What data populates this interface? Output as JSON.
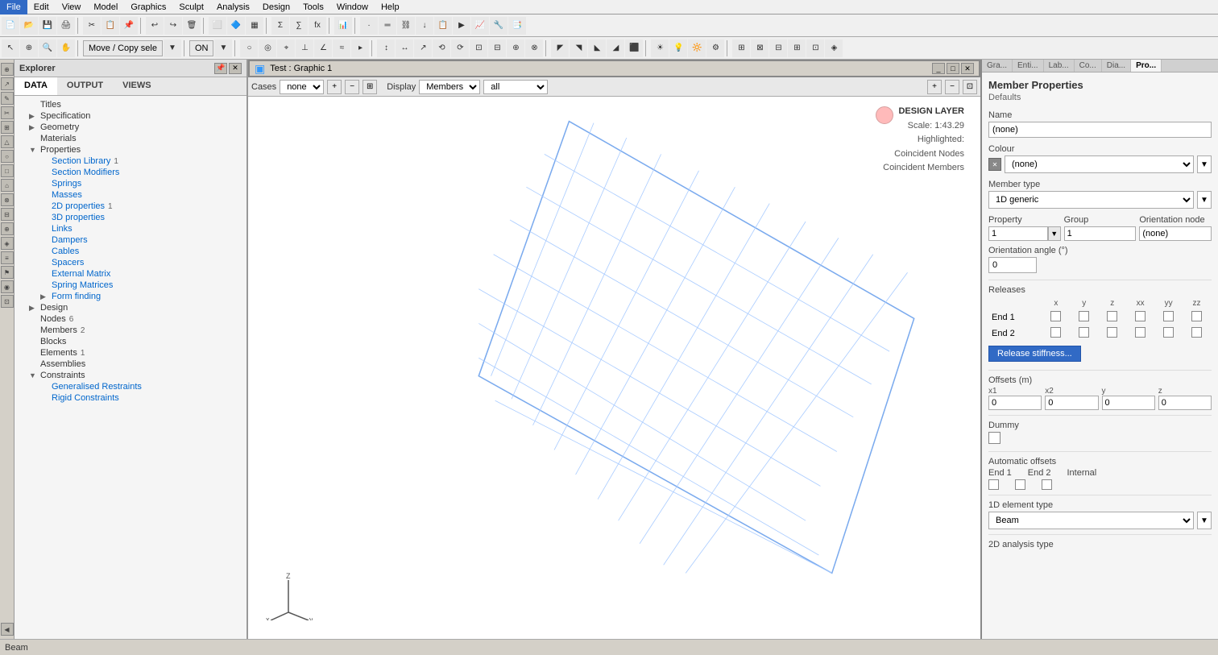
{
  "menubar": {
    "items": [
      "File",
      "Edit",
      "View",
      "Model",
      "Graphics",
      "Sculpt",
      "Analysis",
      "Design",
      "Tools",
      "Window",
      "Help"
    ]
  },
  "explorer": {
    "title": "Explorer",
    "tabs": [
      "DATA",
      "OUTPUT",
      "VIEWS"
    ],
    "active_tab": "DATA",
    "tree": [
      {
        "label": "Titles",
        "indent": 1,
        "type": "leaf",
        "color": "black"
      },
      {
        "label": "Specification",
        "indent": 1,
        "type": "branch",
        "color": "black"
      },
      {
        "label": "Geometry",
        "indent": 1,
        "type": "branch",
        "color": "black"
      },
      {
        "label": "Materials",
        "indent": 1,
        "type": "leaf",
        "color": "black"
      },
      {
        "label": "Properties",
        "indent": 1,
        "type": "branch",
        "color": "black",
        "expanded": true
      },
      {
        "label": "Section Library",
        "indent": 2,
        "type": "leaf",
        "color": "blue",
        "count": "1"
      },
      {
        "label": "Section Modifiers",
        "indent": 2,
        "type": "leaf",
        "color": "blue"
      },
      {
        "label": "Springs",
        "indent": 2,
        "type": "leaf",
        "color": "blue"
      },
      {
        "label": "Masses",
        "indent": 2,
        "type": "leaf",
        "color": "blue"
      },
      {
        "label": "2D properties",
        "indent": 2,
        "type": "leaf",
        "color": "blue",
        "count": "1"
      },
      {
        "label": "3D properties",
        "indent": 2,
        "type": "leaf",
        "color": "blue"
      },
      {
        "label": "Links",
        "indent": 2,
        "type": "leaf",
        "color": "blue"
      },
      {
        "label": "Dampers",
        "indent": 2,
        "type": "leaf",
        "color": "blue"
      },
      {
        "label": "Cables",
        "indent": 2,
        "type": "leaf",
        "color": "blue"
      },
      {
        "label": "Spacers",
        "indent": 2,
        "type": "leaf",
        "color": "blue"
      },
      {
        "label": "External Matrix",
        "indent": 2,
        "type": "leaf",
        "color": "blue"
      },
      {
        "label": "Spring Matrices",
        "indent": 2,
        "type": "leaf",
        "color": "blue"
      },
      {
        "label": "Form finding",
        "indent": 2,
        "type": "branch",
        "color": "blue"
      },
      {
        "label": "Design",
        "indent": 1,
        "type": "branch",
        "color": "black"
      },
      {
        "label": "Nodes",
        "indent": 1,
        "type": "leaf",
        "color": "black",
        "count": "6"
      },
      {
        "label": "Members",
        "indent": 1,
        "type": "leaf",
        "color": "black",
        "count": "2"
      },
      {
        "label": "Blocks",
        "indent": 1,
        "type": "leaf",
        "color": "black"
      },
      {
        "label": "Elements",
        "indent": 1,
        "type": "leaf",
        "color": "black",
        "count": "1"
      },
      {
        "label": "Assemblies",
        "indent": 1,
        "type": "leaf",
        "color": "black"
      },
      {
        "label": "Constraints",
        "indent": 1,
        "type": "branch",
        "color": "black",
        "expanded": true
      },
      {
        "label": "Generalised Restraints",
        "indent": 2,
        "type": "leaf",
        "color": "blue"
      },
      {
        "label": "Rigid Constraints",
        "indent": 2,
        "type": "leaf",
        "color": "blue"
      }
    ]
  },
  "viewport": {
    "title": "Test : Graphic 1",
    "cases_label": "Cases",
    "cases_value": "none",
    "display_label": "Display",
    "display_value": "Members",
    "all_value": "all",
    "design_layer": "DESIGN LAYER",
    "scale": "Scale: 1:43.29",
    "highlighted": "Highlighted:",
    "coincident_nodes": "Coincident Nodes",
    "coincident_members": "Coincident Members"
  },
  "right_panel": {
    "tabs": [
      "Gra...",
      "Enti...",
      "Lab...",
      "Co...",
      "Dia...",
      "Pro..."
    ],
    "active_tab": "Pro...",
    "title": "Member Properties",
    "subtitle": "Defaults",
    "name_label": "Name",
    "name_value": "(none)",
    "colour_label": "Colour",
    "colour_value": "(none)",
    "member_type_label": "Member type",
    "member_type_value": "1D generic",
    "property_label": "Property",
    "property_value": "1",
    "group_label": "Group",
    "group_value": "1",
    "orientation_node_label": "Orientation node",
    "orientation_node_value": "(none)",
    "orientation_angle_label": "Orientation angle (°)",
    "orientation_angle_value": "0",
    "releases_label": "Releases",
    "releases_x": "x",
    "releases_y": "y",
    "releases_z": "z",
    "releases_xx": "xx",
    "releases_yy": "yy",
    "releases_zz": "zz",
    "end1_label": "End 1",
    "end2_label": "End 2",
    "release_stiffness_btn": "Release stiffness...",
    "offsets_label": "Offsets (m)",
    "x1_label": "x1",
    "x2_label": "x2",
    "y_label": "y",
    "z_label": "z",
    "x1_value": "0",
    "x2_value": "0",
    "y_value": "0",
    "z_value": "0",
    "dummy_label": "Dummy",
    "auto_offsets_label": "Automatic offsets",
    "end1_label2": "End 1",
    "end2_label2": "End 2",
    "internal_label": "Internal",
    "element_type_label": "1D element type",
    "element_type_value": "Beam",
    "analysis_type_label": "2D analysis type"
  },
  "statusbar": {
    "text": "Beam"
  }
}
